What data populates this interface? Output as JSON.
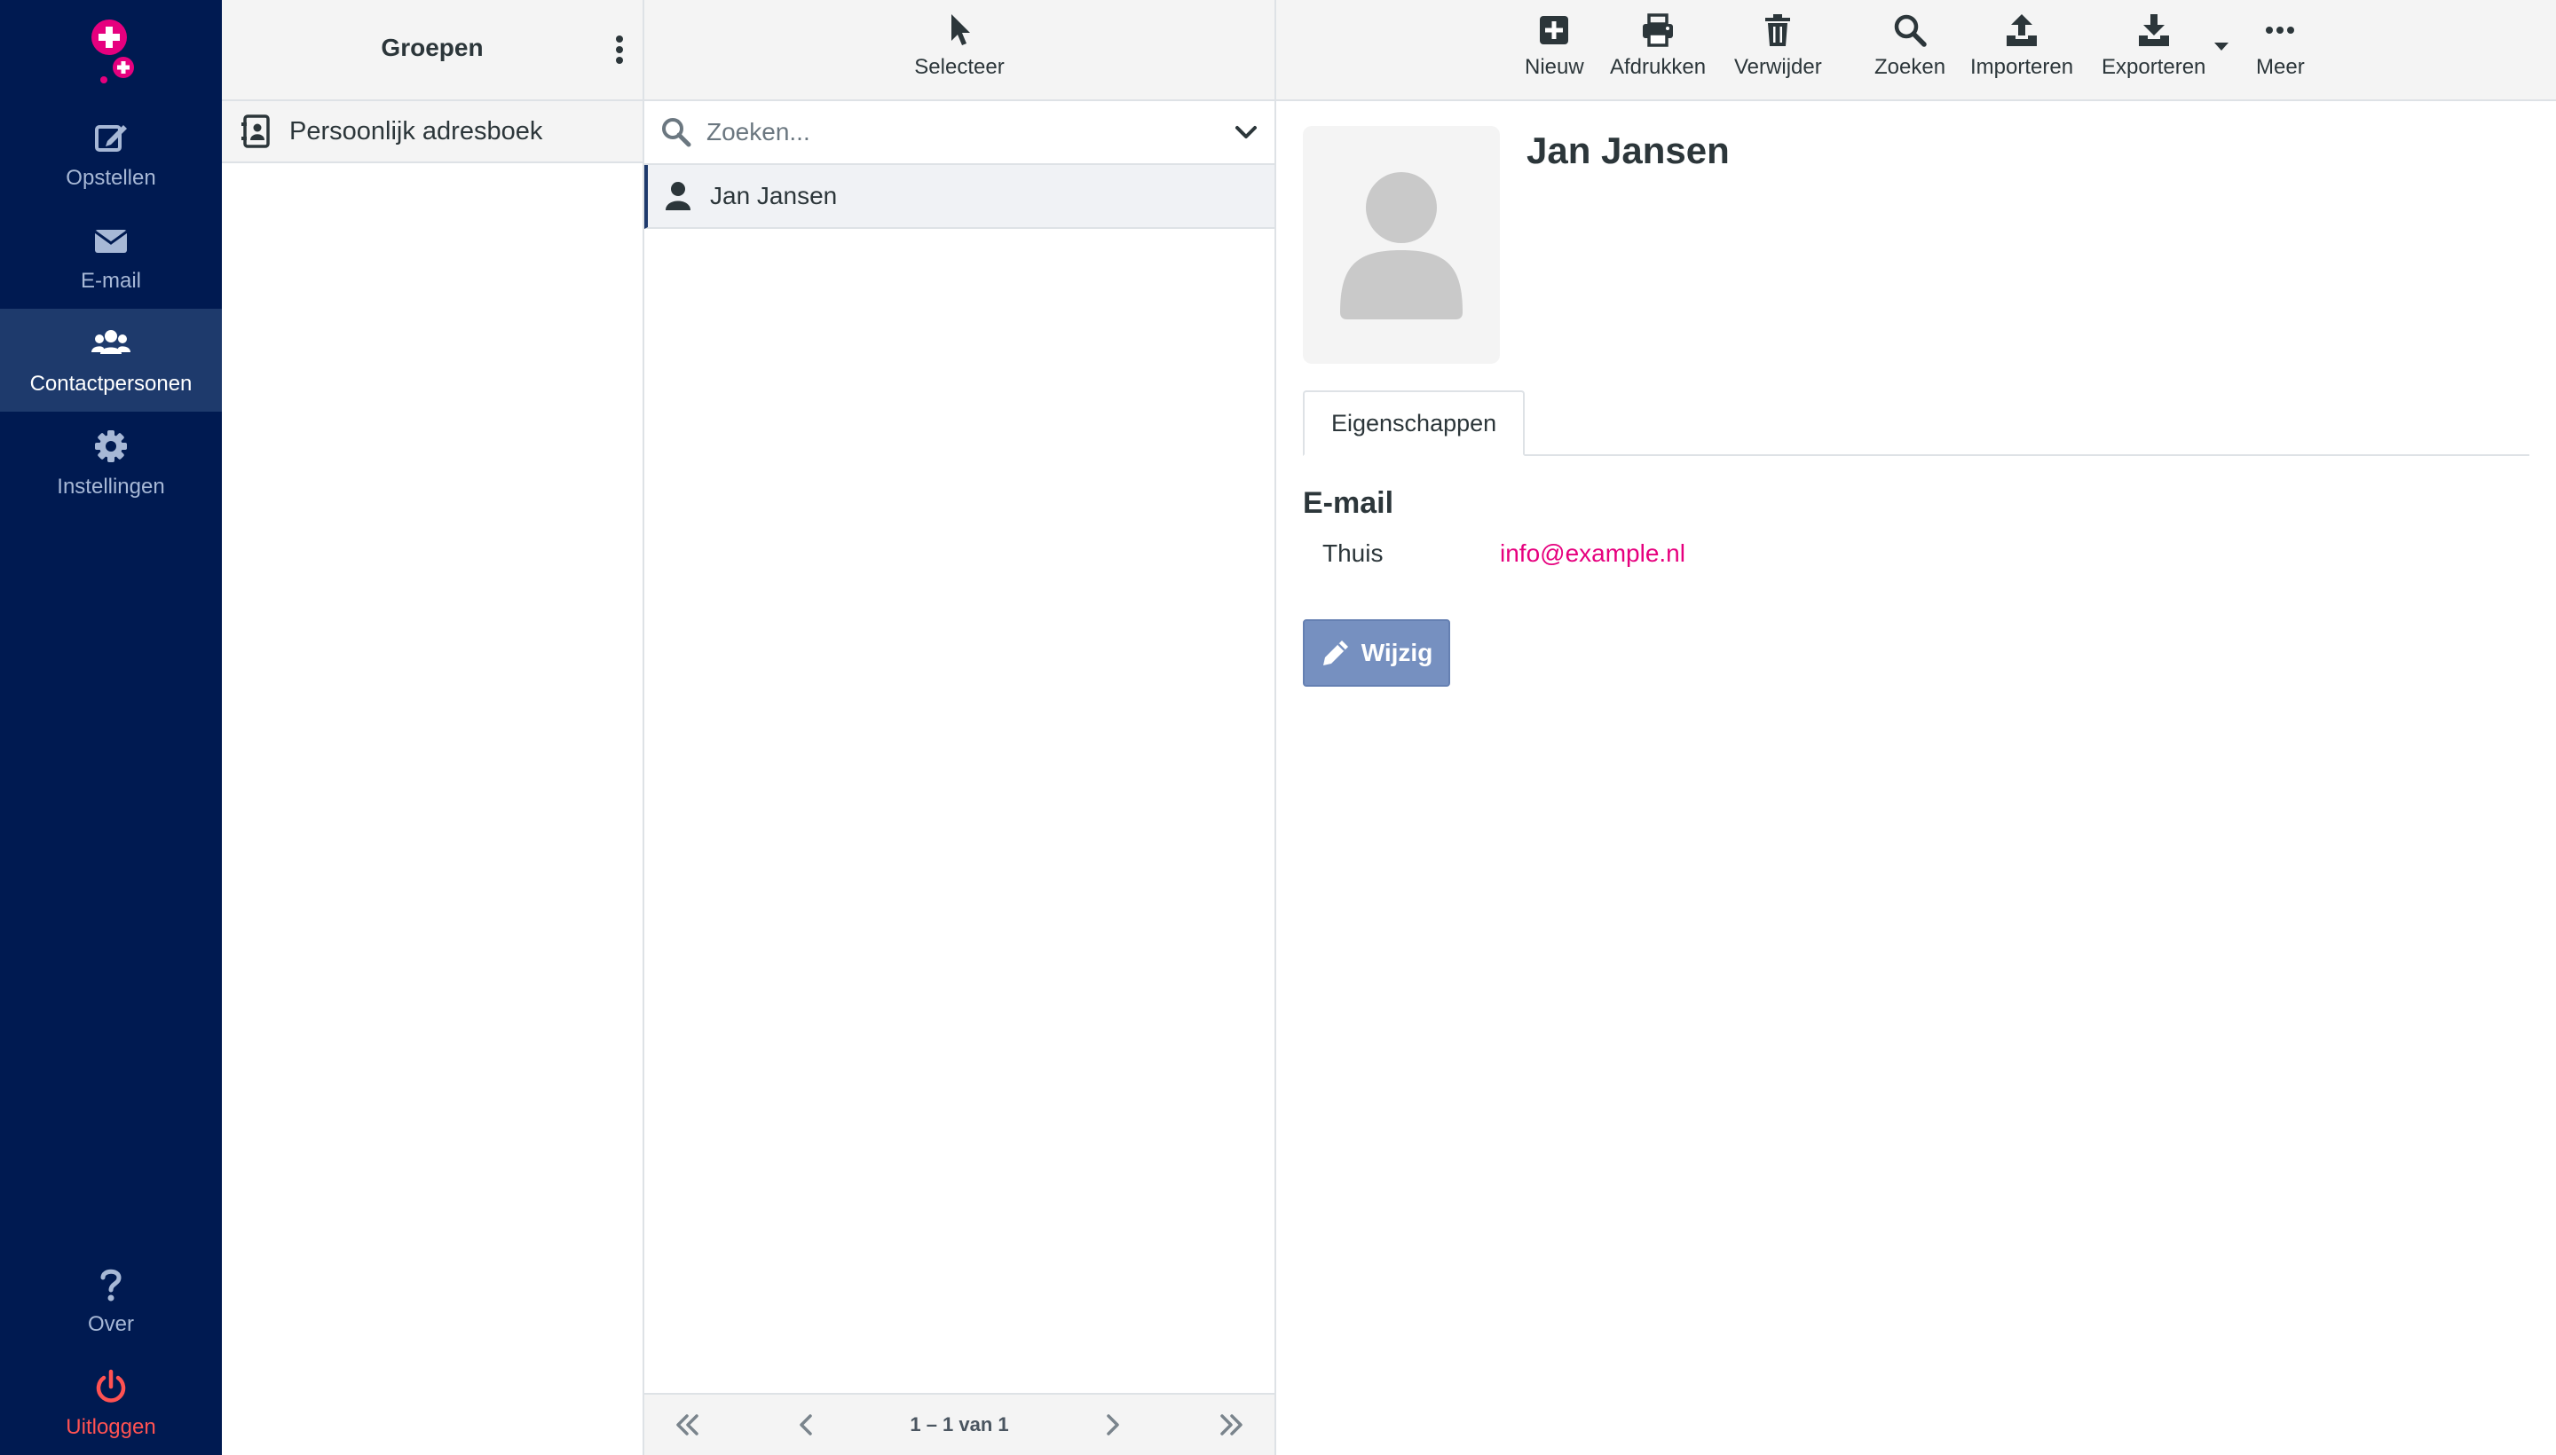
{
  "nav": {
    "items": [
      {
        "label": "Opstellen",
        "icon": "compose-icon"
      },
      {
        "label": "E-mail",
        "icon": "envelope-icon"
      },
      {
        "label": "Contactpersonen",
        "icon": "users-icon",
        "active": true
      },
      {
        "label": "Instellingen",
        "icon": "gear-icon"
      }
    ],
    "bottom": [
      {
        "label": "Over",
        "icon": "question-icon"
      },
      {
        "label": "Uitloggen",
        "icon": "power-icon"
      }
    ]
  },
  "groups": {
    "title": "Groepen",
    "addressbook": "Persoonlijk adresboek"
  },
  "contacts": {
    "select_label": "Selecteer",
    "search_placeholder": "Zoeken...",
    "items": [
      {
        "name": "Jan Jansen"
      }
    ],
    "pager": "1 – 1 van 1"
  },
  "toolbar": {
    "new": "Nieuw",
    "print": "Afdrukken",
    "delete": "Verwijder",
    "search": "Zoeken",
    "import": "Importeren",
    "export": "Exporteren",
    "more": "Meer"
  },
  "details": {
    "name": "Jan Jansen",
    "tab": "Eigenschappen",
    "section": "E-mail",
    "email_type": "Thuis",
    "email": "info@example.nl",
    "edit": "Wijzig"
  },
  "colors": {
    "nav_bg": "#001a51",
    "nav_active": "#1e3a6c",
    "accent": "#e6007e",
    "logout": "#ff5252",
    "button": "#7690c0"
  }
}
